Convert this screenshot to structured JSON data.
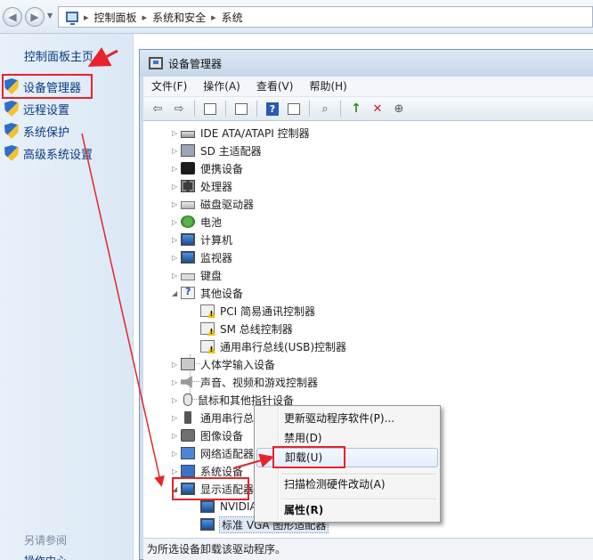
{
  "address_bar": {
    "crumbs": [
      "控制面板",
      "系统和安全",
      "系统"
    ]
  },
  "left_pane": {
    "home": "控制面板主页",
    "links": [
      "设备管理器",
      "远程设置",
      "系统保护",
      "高级系统设置"
    ],
    "see_also": "另请参阅",
    "see_also_item": "操作中心"
  },
  "device_manager": {
    "title": "设备管理器",
    "menu": [
      "文件(F)",
      "操作(A)",
      "查看(V)",
      "帮助(H)"
    ],
    "tree": {
      "ide": "IDE ATA/ATAPI 控制器",
      "sd": "SD 主适配器",
      "portable": "便携设备",
      "cpu": "处理器",
      "disk": "磁盘驱动器",
      "battery": "电池",
      "computer": "计算机",
      "monitor": "监视器",
      "keyboard": "键盘",
      "other": "其他设备",
      "other_children": [
        "PCI 简易通讯控制器",
        "SM 总线控制器",
        "通用串行总线(USB)控制器"
      ],
      "hid": "人体学输入设备",
      "sound": "声音、视频和游戏控制器",
      "mouse": "鼠标和其他指针设备",
      "usb": "通用串行总",
      "imaging": "图像设备",
      "network": "网络适配器",
      "system": "系统设备",
      "display": "显示适配器",
      "display_children": [
        "NVIDIA",
        "标准 VGA 图形适配器"
      ]
    },
    "status": "为所选设备卸载该驱动程序。"
  },
  "context_menu": {
    "items": [
      "更新驱动程序软件(P)...",
      "禁用(D)",
      "卸载(U)",
      "扫描检测硬件改动(A)",
      "属性(R)"
    ]
  },
  "annotation_color": "#e8232b"
}
